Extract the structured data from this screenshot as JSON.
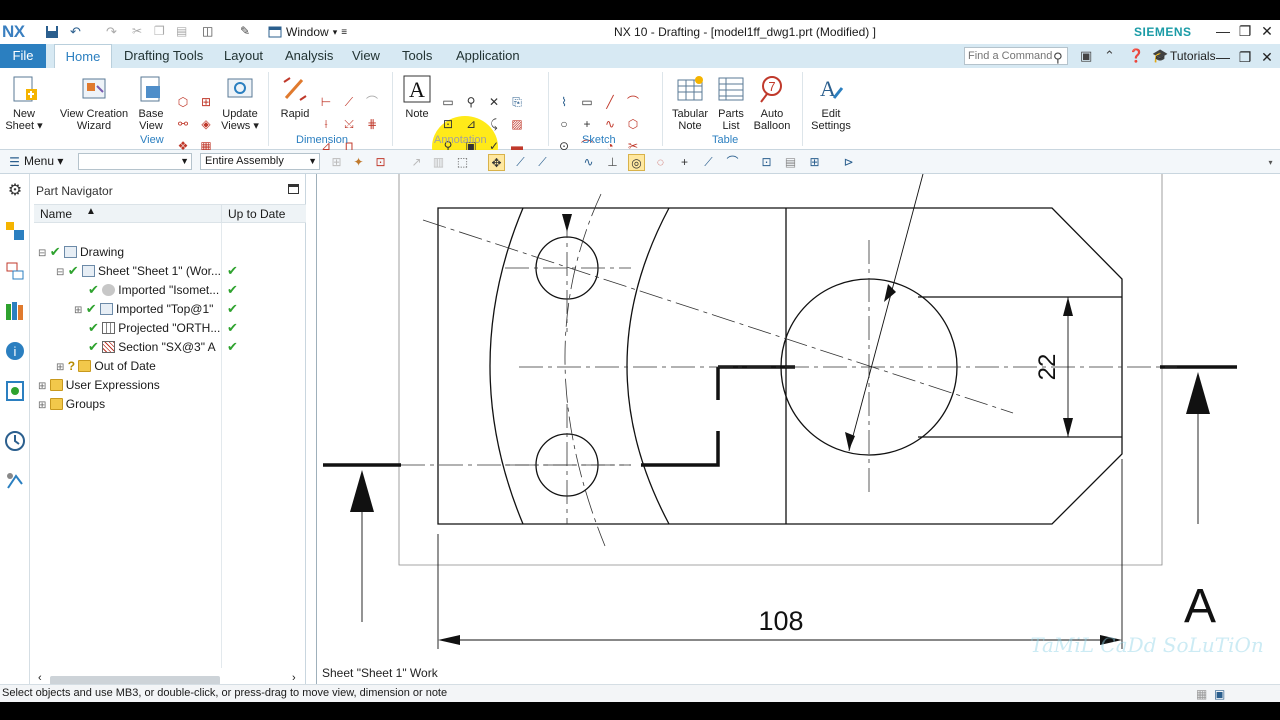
{
  "app": {
    "logo": "NX",
    "window_menu": "Window",
    "title": "NX 10 - Drafting - [model1ff_dwg1.prt  (Modified) ]",
    "brand": "SIEMENS"
  },
  "tabs": {
    "file": "File",
    "items": [
      "Home",
      "Drafting Tools",
      "Layout",
      "Analysis",
      "View",
      "Tools",
      "Application"
    ],
    "find_placeholder": "Find a Command",
    "tutorials": "Tutorials"
  },
  "ribbon": {
    "new_sheet": [
      "New",
      "Sheet ▾"
    ],
    "view_wizard": [
      "View Creation",
      "Wizard"
    ],
    "base_view": [
      "Base",
      "View"
    ],
    "update_views": [
      "Update",
      "Views ▾"
    ],
    "rapid": "Rapid",
    "note": "Note",
    "tabular_note": [
      "Tabular",
      "Note"
    ],
    "parts_list": [
      "Parts",
      "List"
    ],
    "auto_balloon": [
      "Auto",
      "Balloon"
    ],
    "edit_settings": [
      "Edit",
      "Settings"
    ],
    "groups": {
      "view": "View",
      "dimension": "Dimension",
      "annotation": "Annotation",
      "sketch": "Sketch",
      "table": "Table"
    }
  },
  "toolbar2": {
    "menu": "Menu ▾",
    "filter_value": "",
    "scope_value": "Entire Assembly"
  },
  "navigator": {
    "title": "Part Navigator",
    "columns": [
      "Name",
      "Up to Date"
    ],
    "rows": [
      {
        "label": "Drawing",
        "check": "✔",
        "uptodate": ""
      },
      {
        "label": "Sheet \"Sheet 1\" (Wor...",
        "check": "✔",
        "uptodate": "✔"
      },
      {
        "label": "Imported \"Isomet...",
        "check": "✔",
        "uptodate": "✔"
      },
      {
        "label": "Imported \"Top@1\"",
        "check": "✔",
        "uptodate": "✔"
      },
      {
        "label": "Projected \"ORTH...",
        "check": "✔",
        "uptodate": "✔"
      },
      {
        "label": "Section \"SX@3\" A",
        "check": "✔",
        "uptodate": "✔"
      },
      {
        "label": "Out of Date",
        "check": "?",
        "uptodate": ""
      },
      {
        "label": "User Expressions",
        "check": "",
        "uptodate": ""
      },
      {
        "label": "Groups",
        "check": "",
        "uptodate": ""
      }
    ]
  },
  "drawing": {
    "dim_22": "22",
    "dim_108": "108",
    "section_label": "A",
    "sheet_label": "Sheet \"Sheet 1\" Work",
    "watermark": "TaMiL CaDd SoLuTiOn"
  },
  "status": {
    "text": "Select objects and use MB3, or double-click, or press-drag to move view, dimension or note"
  },
  "colors": {
    "accent": "#2b7fc0",
    "check": "#2ea22e",
    "brand": "#1a9ba6",
    "highlight": "#ffe800"
  }
}
